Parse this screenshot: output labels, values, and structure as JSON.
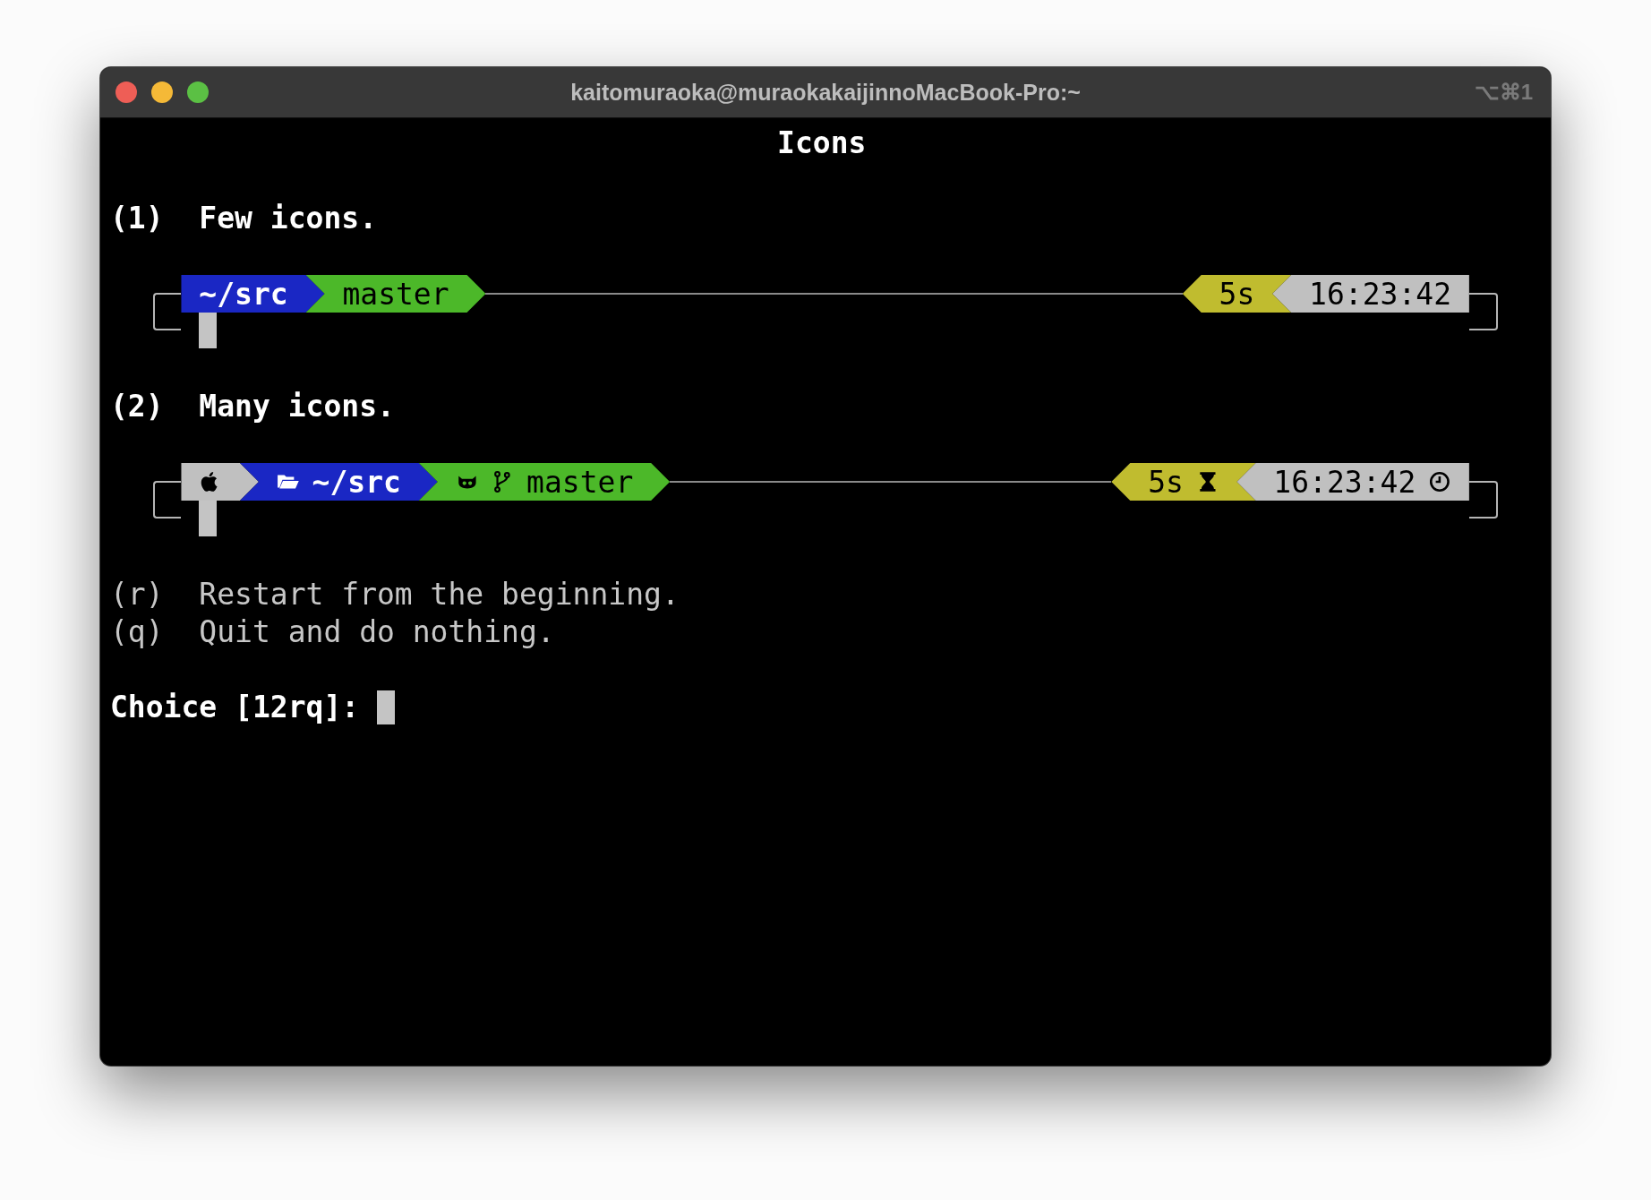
{
  "window": {
    "title": "kaitomuraoka@muraokakaijinnoMacBook-Pro:~",
    "shortcut": "⌥⌘1"
  },
  "terminal": {
    "heading": "Icons",
    "options": [
      {
        "key": "(1)",
        "label": "Few icons.",
        "prompt": {
          "left": [
            {
              "kind": "dir",
              "icon": false,
              "text": "~/src",
              "color": "#1a27c4"
            },
            {
              "kind": "vcs",
              "icon": false,
              "text": "master",
              "color": "#4cb829"
            }
          ],
          "right": [
            {
              "kind": "duration",
              "icon": false,
              "text": "5s",
              "color": "#c0bc2f"
            },
            {
              "kind": "time",
              "icon": false,
              "text": "16:23:42",
              "color": "#c0c0c0"
            }
          ]
        }
      },
      {
        "key": "(2)",
        "label": "Many icons.",
        "prompt": {
          "left": [
            {
              "kind": "os",
              "icon": true,
              "color": "#c0c0c0"
            },
            {
              "kind": "dir",
              "icon": true,
              "text": "~/src",
              "color": "#1a27c4"
            },
            {
              "kind": "vcs",
              "icon": true,
              "text": "master",
              "color": "#4cb829"
            }
          ],
          "right": [
            {
              "kind": "duration",
              "icon": true,
              "text": "5s",
              "color": "#c0bc2f"
            },
            {
              "kind": "time",
              "icon": true,
              "text": "16:23:42",
              "color": "#c0c0c0"
            }
          ]
        }
      }
    ],
    "actions": [
      {
        "key": "(r)",
        "label": "Restart from the beginning."
      },
      {
        "key": "(q)",
        "label": "Quit and do nothing."
      }
    ],
    "input": {
      "label": "Choice [12rq]:"
    }
  }
}
